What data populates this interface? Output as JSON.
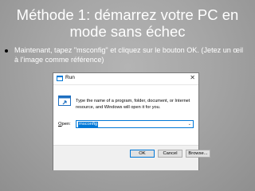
{
  "slide": {
    "title": "Méthode 1: démarrez votre PC en mode sans échec",
    "bullet": "Maintenant, tapez \"msconfig\" et cliquez sur le bouton OK. (Jetez un œil à l'image comme référence)"
  },
  "run_dialog": {
    "title": "Run",
    "close_label": "✕",
    "description": "Type the name of a program, folder, document, or Internet resource, and Windows will open it for you.",
    "open_label_accel": "O",
    "open_label_rest": "pen:",
    "open_value": "msconfig",
    "ok_label": "OK",
    "cancel_label": "Cancel",
    "browse_label": "Browse..."
  },
  "colors": {
    "accent": "#0078d7",
    "slide_background": "#a6a6a6"
  },
  "icons": [
    "run-title-icon",
    "run-program-icon",
    "dropdown-chevron-icon",
    "close-icon"
  ]
}
